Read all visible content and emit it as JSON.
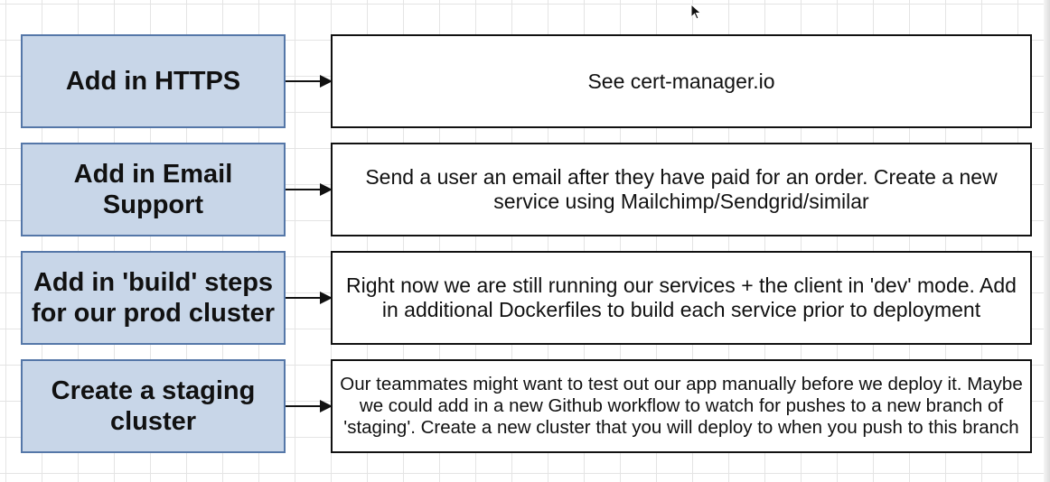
{
  "diagram": {
    "rows": [
      {
        "title": "Add in HTTPS",
        "description": "See cert-manager.io"
      },
      {
        "title": "Add in Email Support",
        "description": "Send a user an email after they have paid for an order.  Create a new service using Mailchimp/Sendgrid/similar"
      },
      {
        "title": "Add in 'build' steps for our prod cluster",
        "description": "Right now we are still running our services + the client in 'dev' mode.  Add in additional Dockerfiles to build each service prior to deployment"
      },
      {
        "title": "Create a staging cluster",
        "description": "Our teammates might want to test out our app manually before we deploy it.  Maybe we could add in a new Github workflow to watch for pushes to a new branch of 'staging'.  Create a new cluster that you will deploy to when you push to this branch"
      }
    ]
  },
  "colors": {
    "task_box_fill": "#c8d6e8",
    "task_box_border": "#5577a8",
    "detail_box_border": "#111111",
    "arrow": "#111111"
  },
  "icons": {
    "cursor": "mouse-pointer-icon",
    "arrow": "arrow-right-icon"
  }
}
